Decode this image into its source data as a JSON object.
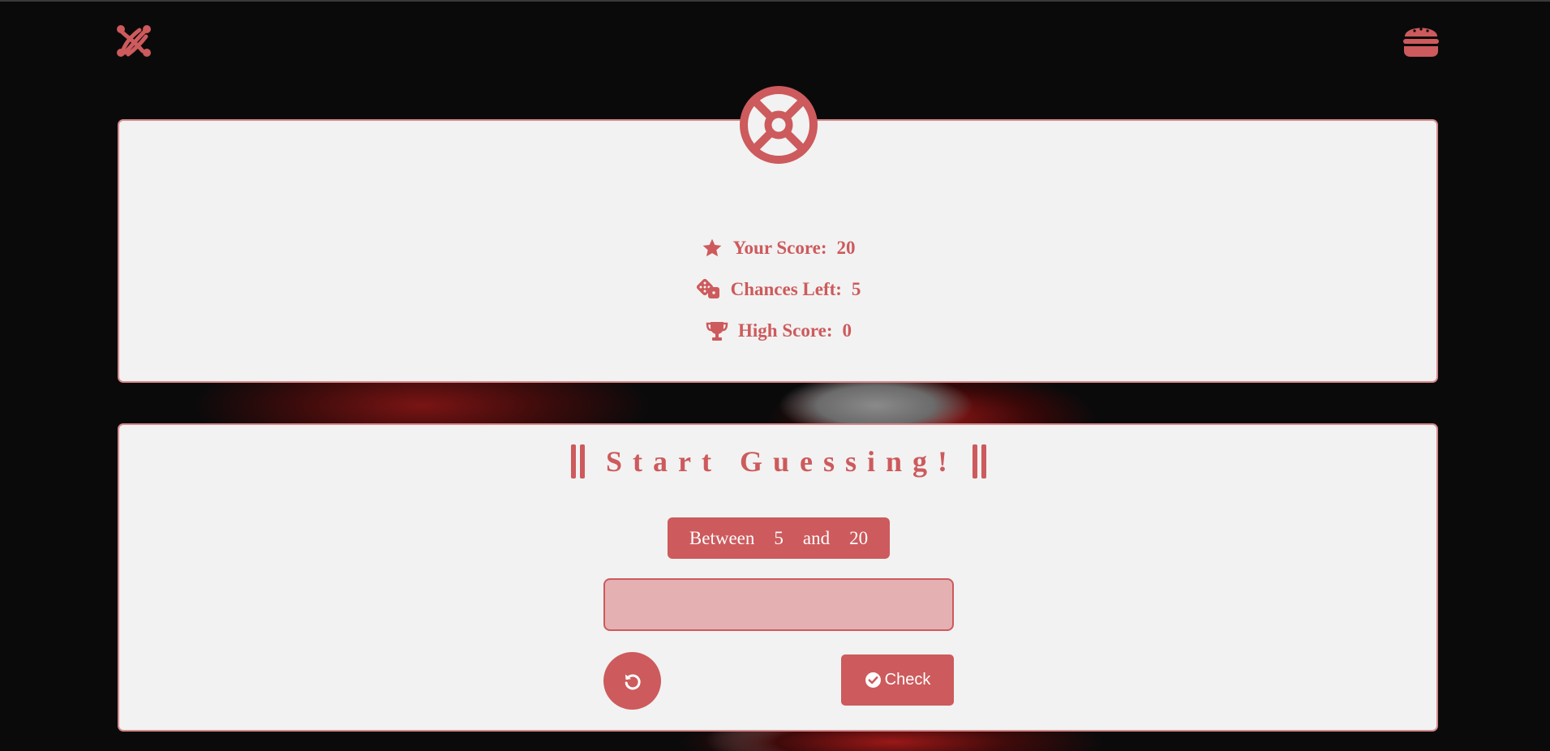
{
  "stats": {
    "score_label": "Your Score:",
    "score_value": "20",
    "chances_label": "Chances Left:",
    "chances_value": "5",
    "highscore_label": "High Score:",
    "highscore_value": "0"
  },
  "game": {
    "title": "Start Guessing!",
    "range_prefix": "Between",
    "range_min": "5",
    "range_joiner": "and",
    "range_max": "20",
    "guess_value": "",
    "check_label": "Check"
  },
  "icons": {
    "logo": "joomla-logo-icon",
    "menu": "hamburger-menu-icon",
    "wheel": "life-ring-icon",
    "score": "star-icon",
    "chances": "dice-icon",
    "highscore": "trophy-icon",
    "reset": "rotate-left-icon",
    "check": "circle-check-icon"
  },
  "colors": {
    "accent": "#cd5a5c",
    "panel": "#f2f2f2",
    "input_bg": "#e5b0b1",
    "page_bg": "#0b0a0b"
  }
}
